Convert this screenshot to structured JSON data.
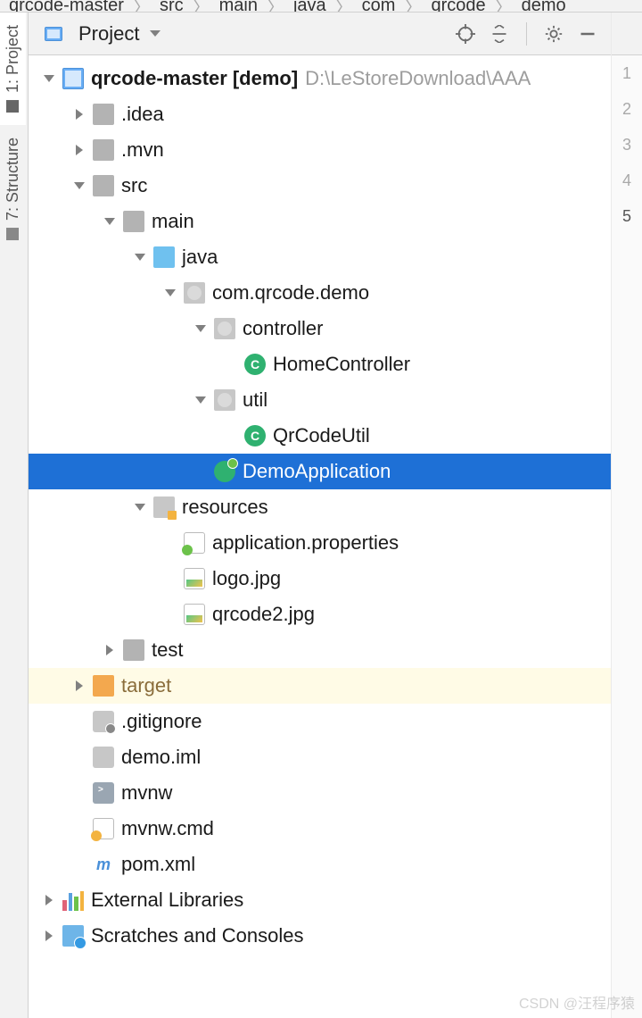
{
  "breadcrumb": [
    "qrcode-master",
    "src",
    "main",
    "java",
    "com",
    "qrcode",
    "demo"
  ],
  "panel": {
    "title": "Project"
  },
  "lines": [
    "1",
    "2",
    "3",
    "4",
    "5"
  ],
  "active_line_index": 4,
  "tool_tabs": {
    "project": "1: Project",
    "structure": "7: Structure"
  },
  "tree": [
    {
      "d": 0,
      "exp": "open",
      "icon": "module",
      "label": "qrcode-master",
      "bold_suffix": "[demo]",
      "grey_suffix": "D:\\LeStoreDownload\\AAA"
    },
    {
      "d": 1,
      "exp": "closed",
      "icon": "folder",
      "label": ".idea"
    },
    {
      "d": 1,
      "exp": "closed",
      "icon": "folder",
      "label": ".mvn"
    },
    {
      "d": 1,
      "exp": "open",
      "icon": "folder",
      "label": "src"
    },
    {
      "d": 2,
      "exp": "open",
      "icon": "folder",
      "label": "main"
    },
    {
      "d": 3,
      "exp": "open",
      "icon": "src-folder",
      "label": "java"
    },
    {
      "d": 4,
      "exp": "open",
      "icon": "pkg",
      "label": "com.qrcode.demo"
    },
    {
      "d": 5,
      "exp": "open",
      "icon": "pkg",
      "label": "controller"
    },
    {
      "d": 6,
      "exp": "none",
      "icon": "class",
      "label": "HomeController"
    },
    {
      "d": 5,
      "exp": "open",
      "icon": "pkg",
      "label": "util"
    },
    {
      "d": 6,
      "exp": "none",
      "icon": "class",
      "label": "QrCodeUtil"
    },
    {
      "d": 5,
      "exp": "none",
      "icon": "spring",
      "label": "DemoApplication",
      "selected": true
    },
    {
      "d": 3,
      "exp": "open",
      "icon": "res-folder",
      "label": "resources"
    },
    {
      "d": 4,
      "exp": "none",
      "icon": "props",
      "label": "application.properties"
    },
    {
      "d": 4,
      "exp": "none",
      "icon": "img",
      "label": "logo.jpg"
    },
    {
      "d": 4,
      "exp": "none",
      "icon": "img",
      "label": "qrcode2.jpg"
    },
    {
      "d": 2,
      "exp": "closed",
      "icon": "folder",
      "label": "test"
    },
    {
      "d": 1,
      "exp": "closed",
      "icon": "target",
      "label": "target",
      "hl": "yellow",
      "brown": true
    },
    {
      "d": 1,
      "exp": "none",
      "icon": "git",
      "label": ".gitignore"
    },
    {
      "d": 1,
      "exp": "none",
      "icon": "iml",
      "label": "demo.iml"
    },
    {
      "d": 1,
      "exp": "none",
      "icon": "sh",
      "label": "mvnw"
    },
    {
      "d": 1,
      "exp": "none",
      "icon": "cmd",
      "label": "mvnw.cmd"
    },
    {
      "d": 1,
      "exp": "none",
      "icon": "maven",
      "label": "pom.xml"
    },
    {
      "d": 0,
      "exp": "closed",
      "icon": "libs",
      "label": "External Libraries"
    },
    {
      "d": 0,
      "exp": "closed",
      "icon": "scratch",
      "label": "Scratches and Consoles"
    }
  ],
  "watermark": "CSDN @汪程序猿"
}
